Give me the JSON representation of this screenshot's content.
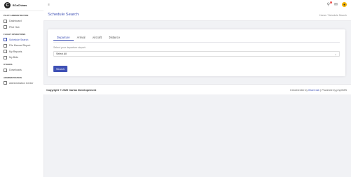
{
  "brand": {
    "logo": "C",
    "name": "BCaChinas"
  },
  "sidebar": {
    "sections": [
      {
        "title": "Pilot Administration",
        "items": [
          {
            "label": "Dashboard",
            "icon": "home-icon"
          },
          {
            "label": "Pilot Hub",
            "icon": "monitor-icon"
          }
        ]
      },
      {
        "title": "Flight Operations",
        "items": [
          {
            "label": "Schedule Search",
            "icon": "search-icon",
            "active": true
          },
          {
            "label": "File Manual Report",
            "icon": "file-icon"
          },
          {
            "label": "My Reports",
            "icon": "report-icon"
          },
          {
            "label": "My Bids",
            "icon": "bids-icon"
          }
        ]
      },
      {
        "title": "Others",
        "items": [
          {
            "label": "Downloads",
            "icon": "download-icon"
          }
        ]
      },
      {
        "title": "Administration",
        "items": [
          {
            "label": "Administration Center",
            "icon": "gear-icon"
          }
        ]
      }
    ]
  },
  "topbar": {
    "notification_count": "2"
  },
  "page": {
    "title": "Schedule Search",
    "breadcrumb": {
      "home": "Home",
      "separator": "/",
      "current": "Schedule Search"
    }
  },
  "search": {
    "tabs": [
      "Departure",
      "Arrival",
      "Aircraft",
      "Distance"
    ],
    "active_tab": "Departure",
    "hint": "Select your departure airport:",
    "select_value": "Select All",
    "button_label": "Search"
  },
  "footer": {
    "copyright": "Copyright © 2020 Carlos Developement",
    "powered_prefix": "CrewCenter by",
    "powered_author": "BlueCrab",
    "powered_suffix": "| Powered by phpVMS"
  },
  "colors": {
    "accent": "#3f51b5",
    "badge": "#e53935",
    "avatar": "#f5b400"
  }
}
